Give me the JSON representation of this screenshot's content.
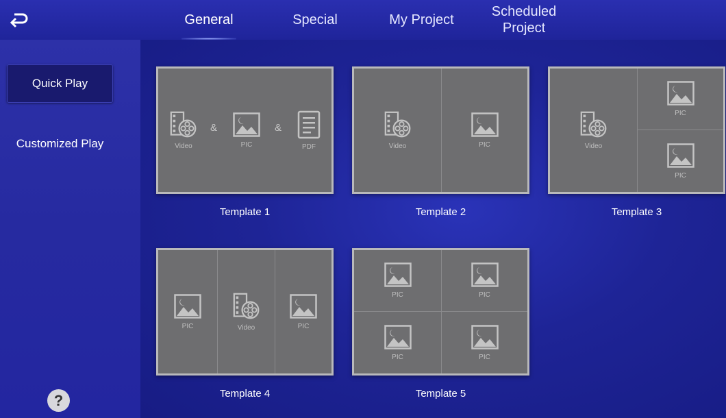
{
  "header": {
    "tabs": [
      {
        "label": "General",
        "active": true
      },
      {
        "label": "Special",
        "active": false
      },
      {
        "label": "My Project",
        "active": false
      },
      {
        "label_line1": "Scheduled",
        "label_line2": "Project",
        "active": false
      }
    ]
  },
  "sidebar": {
    "items": [
      {
        "label": "Quick Play",
        "active": true
      },
      {
        "label": "Customized Play",
        "active": false
      }
    ],
    "help_label": "?"
  },
  "templates": [
    {
      "name": "Template 1",
      "cells": [
        "Video",
        "PIC",
        "PDF"
      ],
      "separator": "&"
    },
    {
      "name": "Template 2",
      "cells": [
        "Video",
        "PIC"
      ]
    },
    {
      "name": "Template 3",
      "cells": [
        "Video",
        "PIC",
        "PIC"
      ]
    },
    {
      "name": "Template 4",
      "cells": [
        "PIC",
        "Video",
        "PIC"
      ]
    },
    {
      "name": "Template 5",
      "cells": [
        "PIC",
        "PIC",
        "PIC",
        "PIC"
      ]
    }
  ],
  "colors": {
    "accent": "#2a2fb0",
    "background": "#1a1f8c",
    "tile": "#6e6e70"
  },
  "icons": [
    "back-arrow-icon",
    "video-icon",
    "picture-icon",
    "pdf-icon",
    "help-icon"
  ]
}
